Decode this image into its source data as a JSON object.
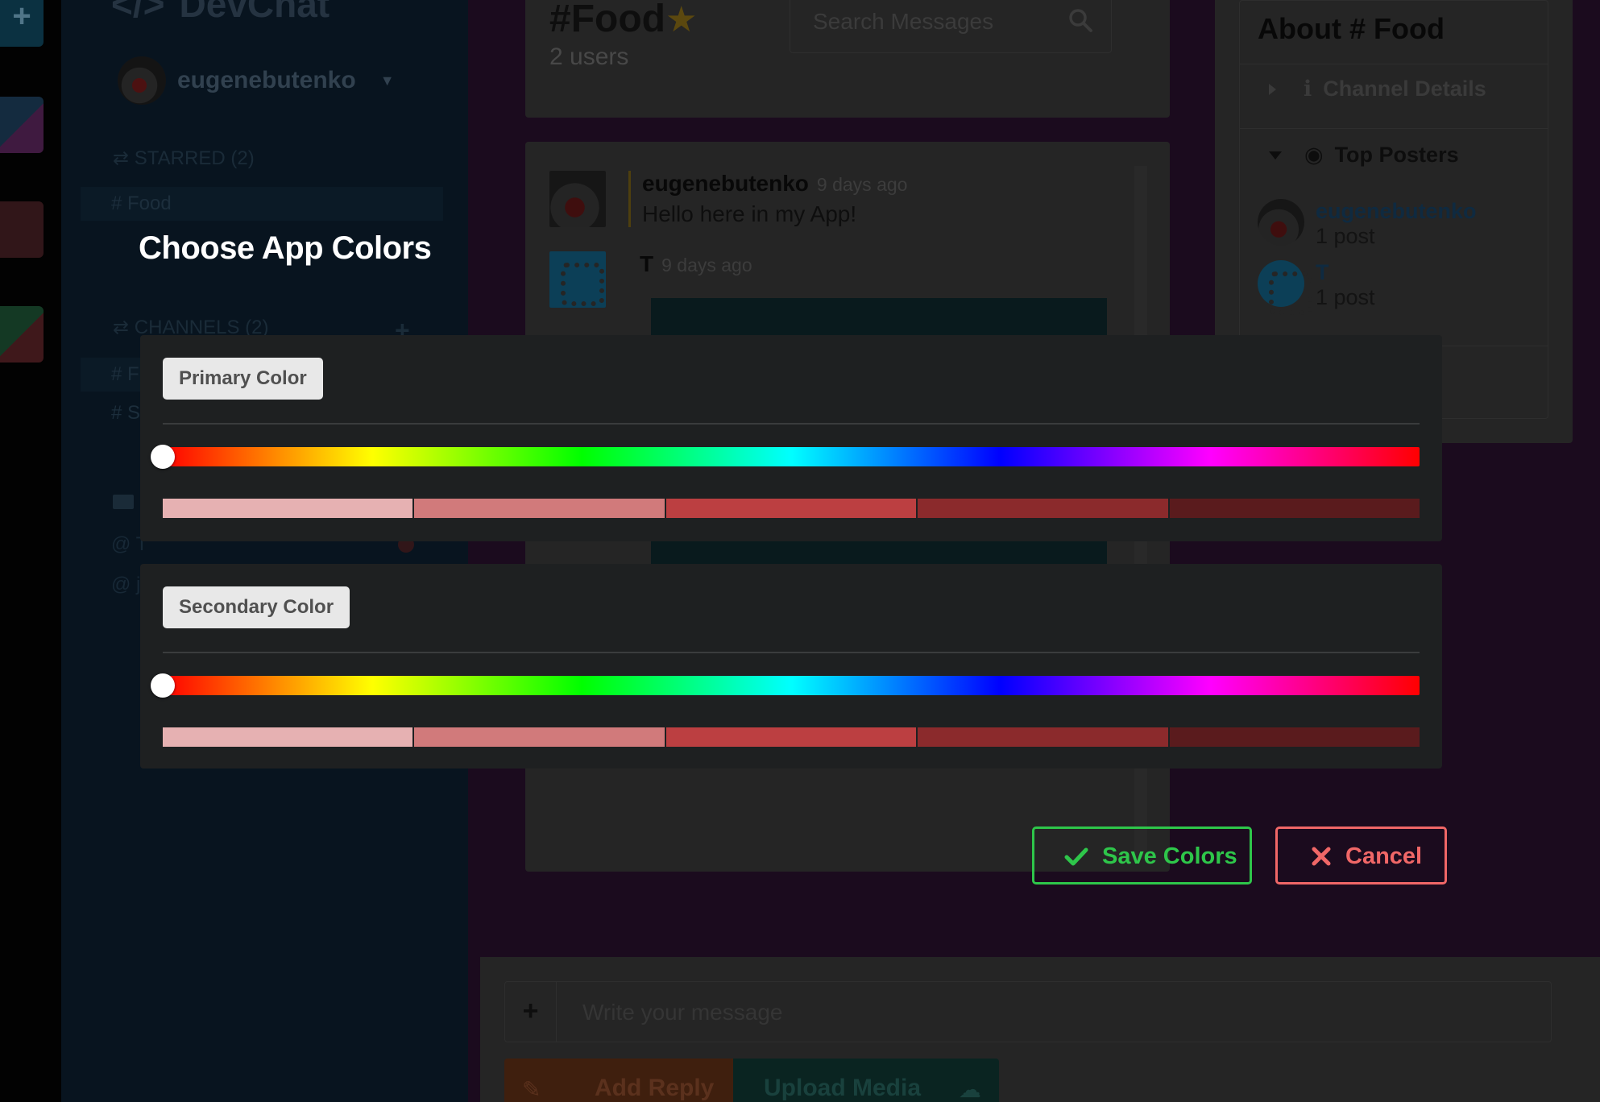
{
  "sidebar": {
    "logo": "DevChat",
    "user_name": "eugenebutenko",
    "starred_heading": "STARRED (2)",
    "starred_items": [
      "# Food"
    ],
    "channels_heading": "CHANNELS (2)",
    "channel_items": [
      "# F",
      "# S"
    ],
    "dm_items": [
      "@ T",
      "@ jo"
    ]
  },
  "channel": {
    "title": "#Food",
    "user_count": "2 users",
    "search_placeholder": "Search Messages"
  },
  "messages": [
    {
      "user": "eugenebutenko",
      "time": "9 days ago",
      "text": "Hello here in my App!"
    },
    {
      "user": "T",
      "time": "9 days ago",
      "text": ""
    }
  ],
  "about_panel": {
    "title": "About # Food",
    "channel_details": "Channel Details",
    "top_posters": "Top Posters",
    "posters": [
      {
        "name": "eugenebutenko",
        "count": "1 post"
      },
      {
        "name": "T",
        "count": "1 post"
      }
    ]
  },
  "compose": {
    "placeholder": "Write your message",
    "add_reply": "Add Reply",
    "upload_media": "Upload Media"
  },
  "modal": {
    "title": "Choose App Colors",
    "primary": {
      "label": "Primary Color",
      "hue_value": 0,
      "swatches": [
        "#e6b1b2",
        "#d17a7b",
        "#bc3f41",
        "#8b2a2c",
        "#5a1b1d"
      ]
    },
    "secondary": {
      "label": "Secondary Color",
      "hue_value": 0,
      "swatches": [
        "#e6b1b2",
        "#d17a7b",
        "#bc3f41",
        "#8b2a2c",
        "#5a1b1d"
      ]
    },
    "save_label": "Save Colors",
    "cancel_label": "Cancel"
  },
  "colors": {
    "save_accent": "#2ec64a",
    "cancel_accent": "#f06767",
    "panel_bg": "#1e2021",
    "hue_gradient": [
      "#ff0000",
      "#ffff00",
      "#00ff00",
      "#00ffff",
      "#0000ff",
      "#ff00ff",
      "#ff0000"
    ]
  }
}
